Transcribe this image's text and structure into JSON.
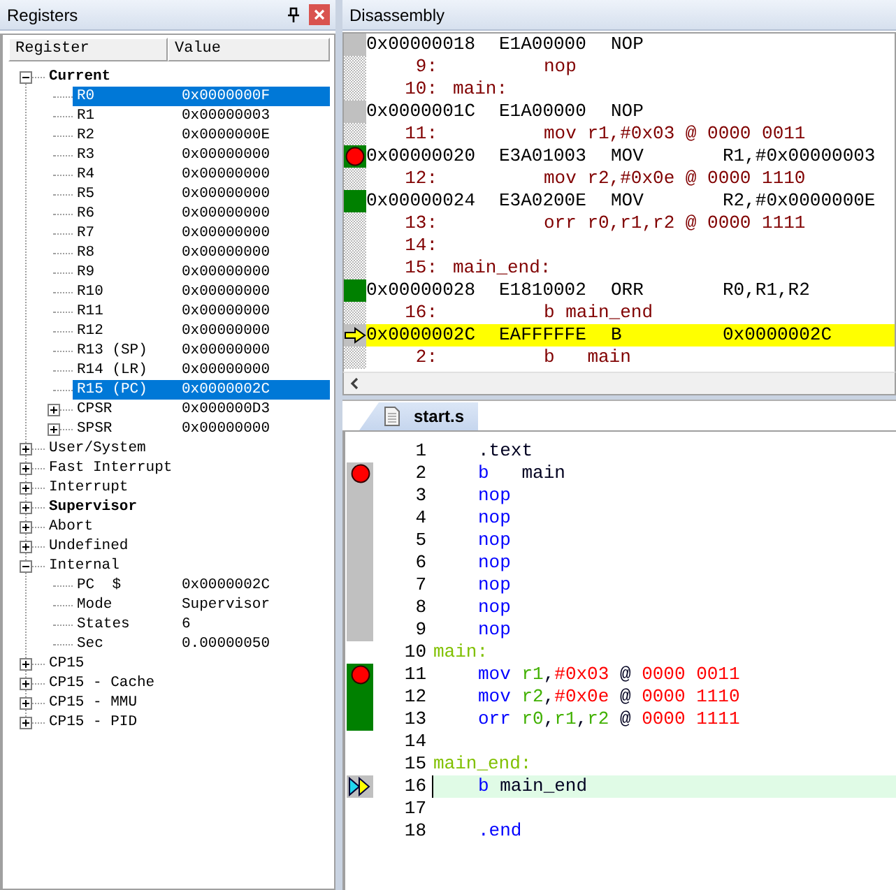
{
  "registers": {
    "title": "Registers",
    "columns": [
      "Register",
      "Value"
    ],
    "items": [
      {
        "name": "Current",
        "bold": true,
        "expanded": true,
        "selected": false,
        "children": [
          {
            "name": "R0",
            "value": "0x0000000F",
            "bold": false,
            "selected": true
          },
          {
            "name": "R1",
            "value": "0x00000003",
            "bold": false,
            "selected": false
          },
          {
            "name": "R2",
            "value": "0x0000000E",
            "bold": false,
            "selected": false
          },
          {
            "name": "R3",
            "value": "0x00000000",
            "bold": false,
            "selected": false
          },
          {
            "name": "R4",
            "value": "0x00000000",
            "bold": false,
            "selected": false
          },
          {
            "name": "R5",
            "value": "0x00000000",
            "bold": false,
            "selected": false
          },
          {
            "name": "R6",
            "value": "0x00000000",
            "bold": false,
            "selected": false
          },
          {
            "name": "R7",
            "value": "0x00000000",
            "bold": false,
            "selected": false
          },
          {
            "name": "R8",
            "value": "0x00000000",
            "bold": false,
            "selected": false
          },
          {
            "name": "R9",
            "value": "0x00000000",
            "bold": false,
            "selected": false
          },
          {
            "name": "R10",
            "value": "0x00000000",
            "bold": false,
            "selected": false
          },
          {
            "name": "R11",
            "value": "0x00000000",
            "bold": false,
            "selected": false
          },
          {
            "name": "R12",
            "value": "0x00000000",
            "bold": false,
            "selected": false
          },
          {
            "name": "R13 (SP)",
            "value": "0x00000000",
            "bold": false,
            "selected": false
          },
          {
            "name": "R14 (LR)",
            "value": "0x00000000",
            "bold": false,
            "selected": false
          },
          {
            "name": "R15 (PC)",
            "value": "0x0000002C",
            "bold": false,
            "selected": true
          },
          {
            "name": "CPSR",
            "value": "0x000000D3",
            "bold": false,
            "expanded": false,
            "selected": false
          },
          {
            "name": "SPSR",
            "value": "0x00000000",
            "bold": false,
            "expanded": false,
            "selected": false
          }
        ]
      },
      {
        "name": "User/System",
        "bold": false,
        "expanded": false,
        "selected": false
      },
      {
        "name": "Fast Interrupt",
        "bold": false,
        "expanded": false,
        "selected": false
      },
      {
        "name": "Interrupt",
        "bold": false,
        "expanded": false,
        "selected": false
      },
      {
        "name": "Supervisor",
        "bold": true,
        "expanded": false,
        "selected": false
      },
      {
        "name": "Abort",
        "bold": false,
        "expanded": false,
        "selected": false
      },
      {
        "name": "Undefined",
        "bold": false,
        "expanded": false,
        "selected": false
      },
      {
        "name": "Internal",
        "bold": false,
        "expanded": true,
        "selected": false,
        "children": [
          {
            "name": "PC  $",
            "value": "0x0000002C",
            "bold": false,
            "selected": false
          },
          {
            "name": "Mode",
            "value": "Supervisor",
            "bold": false,
            "selected": false
          },
          {
            "name": "States",
            "value": "6",
            "bold": false,
            "selected": false
          },
          {
            "name": "Sec",
            "value": "0.00000050",
            "bold": false,
            "selected": false
          }
        ]
      },
      {
        "name": "CP15",
        "bold": false,
        "expanded": false,
        "selected": false
      },
      {
        "name": "CP15 - Cache",
        "bold": false,
        "expanded": false,
        "selected": false
      },
      {
        "name": "CP15 - MMU",
        "bold": false,
        "expanded": false,
        "selected": false
      },
      {
        "name": "CP15 - PID",
        "bold": false,
        "expanded": false,
        "selected": false
      }
    ]
  },
  "disassembly": {
    "title": "Disassembly",
    "rows": [
      {
        "kind": "asm",
        "address": "0x00000018",
        "opcode": "E1A00000",
        "mnemonic": "NOP",
        "executed": false,
        "breakpoint": false,
        "current": false
      },
      {
        "kind": "source",
        "line": "9:",
        "text": "nop"
      },
      {
        "kind": "source",
        "line": "10:",
        "label": "main:"
      },
      {
        "kind": "asm",
        "address": "0x0000001C",
        "opcode": "E1A00000",
        "mnemonic": "NOP",
        "executed": false,
        "breakpoint": false,
        "current": false
      },
      {
        "kind": "source",
        "line": "11:",
        "text": "mov r1,#0x03 @ 0000 0011"
      },
      {
        "kind": "asm",
        "address": "0x00000020",
        "opcode": "E3A01003",
        "mnemonic": "MOV",
        "operands": "R1,#0x00000003",
        "executed": true,
        "breakpoint": true,
        "current": false
      },
      {
        "kind": "source",
        "line": "12:",
        "text": "mov r2,#0x0e @ 0000 1110"
      },
      {
        "kind": "asm",
        "address": "0x00000024",
        "opcode": "E3A0200E",
        "mnemonic": "MOV",
        "operands": "R2,#0x0000000E",
        "executed": true,
        "breakpoint": false,
        "current": false
      },
      {
        "kind": "source",
        "line": "13:",
        "text": "orr r0,r1,r2 @ 0000 1111"
      },
      {
        "kind": "source",
        "line": "14:"
      },
      {
        "kind": "source",
        "line": "15:",
        "label": "main_end:"
      },
      {
        "kind": "asm",
        "address": "0x00000028",
        "opcode": "E1810002",
        "mnemonic": "ORR",
        "operands": "R0,R1,R2",
        "executed": true,
        "breakpoint": false,
        "current": false
      },
      {
        "kind": "source",
        "line": "16:",
        "text": "b main_end"
      },
      {
        "kind": "asm",
        "address": "0x0000002C",
        "opcode": "EAFFFFFE",
        "mnemonic": "B",
        "operands": "0x0000002C",
        "executed": false,
        "breakpoint": false,
        "current": true
      },
      {
        "kind": "source",
        "line": "2:",
        "text": "b   main"
      }
    ]
  },
  "editor": {
    "tab": "start.s",
    "lines": [
      {
        "number": "1",
        "indented": true,
        "executable": false,
        "executed": false,
        "breakpoint": false,
        "current": false,
        "tokens": [
          {
            "kind": "plain",
            "text": ".text"
          }
        ]
      },
      {
        "number": "2",
        "indented": true,
        "executable": true,
        "executed": false,
        "breakpoint": true,
        "current": false,
        "tokens": [
          {
            "kind": "keyword",
            "text": "b"
          },
          {
            "kind": "plain",
            "text": "   main"
          }
        ]
      },
      {
        "number": "3",
        "indented": true,
        "executable": true,
        "executed": false,
        "breakpoint": false,
        "current": false,
        "tokens": [
          {
            "kind": "keyword",
            "text": "nop"
          }
        ]
      },
      {
        "number": "4",
        "indented": true,
        "executable": true,
        "executed": false,
        "breakpoint": false,
        "current": false,
        "tokens": [
          {
            "kind": "keyword",
            "text": "nop"
          }
        ]
      },
      {
        "number": "5",
        "indented": true,
        "executable": true,
        "executed": false,
        "breakpoint": false,
        "current": false,
        "tokens": [
          {
            "kind": "keyword",
            "text": "nop"
          }
        ]
      },
      {
        "number": "6",
        "indented": true,
        "executable": true,
        "executed": false,
        "breakpoint": false,
        "current": false,
        "tokens": [
          {
            "kind": "keyword",
            "text": "nop"
          }
        ]
      },
      {
        "number": "7",
        "indented": true,
        "executable": true,
        "executed": false,
        "breakpoint": false,
        "current": false,
        "tokens": [
          {
            "kind": "keyword",
            "text": "nop"
          }
        ]
      },
      {
        "number": "8",
        "indented": true,
        "executable": true,
        "executed": false,
        "breakpoint": false,
        "current": false,
        "tokens": [
          {
            "kind": "keyword",
            "text": "nop"
          }
        ]
      },
      {
        "number": "9",
        "indented": true,
        "executable": true,
        "executed": false,
        "breakpoint": false,
        "current": false,
        "tokens": [
          {
            "kind": "keyword",
            "text": "nop"
          }
        ]
      },
      {
        "number": "10",
        "indented": false,
        "executable": false,
        "executed": false,
        "breakpoint": false,
        "current": false,
        "tokens": [
          {
            "kind": "label",
            "text": "main:"
          }
        ]
      },
      {
        "number": "11",
        "indented": true,
        "executable": true,
        "executed": true,
        "breakpoint": true,
        "current": false,
        "tokens": [
          {
            "kind": "keyword",
            "text": "mov "
          },
          {
            "kind": "register",
            "text": "r1"
          },
          {
            "kind": "plain",
            "text": ","
          },
          {
            "kind": "number",
            "text": "#0x03"
          },
          {
            "kind": "plain",
            "text": " @ "
          },
          {
            "kind": "number",
            "text": "0000 0011"
          }
        ]
      },
      {
        "number": "12",
        "indented": true,
        "executable": true,
        "executed": true,
        "breakpoint": false,
        "current": false,
        "tokens": [
          {
            "kind": "keyword",
            "text": "mov "
          },
          {
            "kind": "register",
            "text": "r2"
          },
          {
            "kind": "plain",
            "text": ","
          },
          {
            "kind": "number",
            "text": "#0x0e"
          },
          {
            "kind": "plain",
            "text": " @ "
          },
          {
            "kind": "number",
            "text": "0000 1110"
          }
        ]
      },
      {
        "number": "13",
        "indented": true,
        "executable": true,
        "executed": true,
        "breakpoint": false,
        "current": false,
        "tokens": [
          {
            "kind": "keyword",
            "text": "orr "
          },
          {
            "kind": "register",
            "text": "r0"
          },
          {
            "kind": "plain",
            "text": ","
          },
          {
            "kind": "register",
            "text": "r1"
          },
          {
            "kind": "plain",
            "text": ","
          },
          {
            "kind": "register",
            "text": "r2"
          },
          {
            "kind": "plain",
            "text": " @ "
          },
          {
            "kind": "number",
            "text": "0000 1111"
          }
        ]
      },
      {
        "number": "14",
        "executable": false,
        "executed": false,
        "breakpoint": false,
        "current": false
      },
      {
        "number": "15",
        "indented": false,
        "executable": false,
        "executed": false,
        "breakpoint": false,
        "current": false,
        "tokens": [
          {
            "kind": "label",
            "text": "main_end:"
          }
        ]
      },
      {
        "number": "16",
        "indented": true,
        "executable": true,
        "executed": false,
        "breakpoint": false,
        "current": true,
        "tokens": [
          {
            "kind": "keyword",
            "text": "b"
          },
          {
            "kind": "plain",
            "text": " main_end"
          }
        ]
      },
      {
        "number": "17",
        "executable": false,
        "executed": false,
        "breakpoint": false,
        "current": false
      },
      {
        "number": "18",
        "indented": true,
        "executable": false,
        "executed": false,
        "breakpoint": false,
        "current": false,
        "tokens": [
          {
            "kind": "keyword",
            "text": ".end"
          }
        ]
      }
    ]
  }
}
